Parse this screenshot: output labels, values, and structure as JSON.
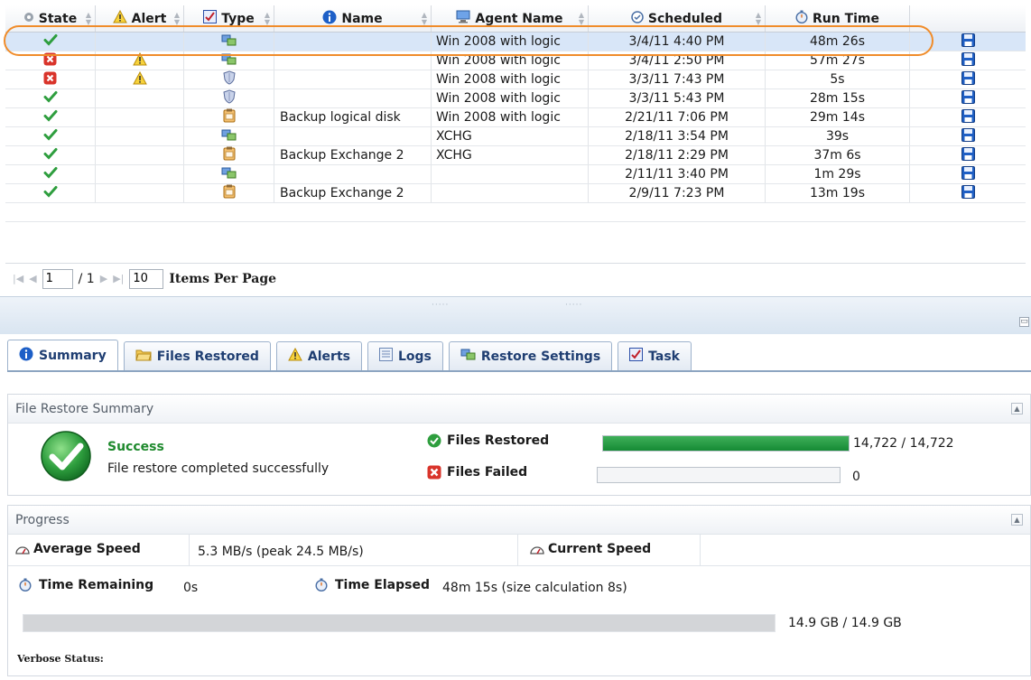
{
  "columns": {
    "state": "State",
    "alert": "Alert",
    "type": "Type",
    "name": "Name",
    "agent": "Agent Name",
    "scheduled": "Scheduled",
    "run_time": "Run Time"
  },
  "rows": [
    {
      "state": "ok",
      "alert": false,
      "type": "restore",
      "name": "",
      "agent": "Win 2008 with logic",
      "scheduled": "3/4/11 4:40 PM",
      "run_time": "48m 26s",
      "selected": true
    },
    {
      "state": "error",
      "alert": true,
      "type": "restore",
      "name": "",
      "agent": "Win 2008 with logic",
      "scheduled": "3/4/11 2:50 PM",
      "run_time": "57m 27s",
      "selected": false
    },
    {
      "state": "error",
      "alert": true,
      "type": "shield",
      "name": "",
      "agent": "Win 2008 with logic",
      "scheduled": "3/3/11 7:43 PM",
      "run_time": "5s",
      "selected": false
    },
    {
      "state": "ok",
      "alert": false,
      "type": "shield",
      "name": "",
      "agent": "Win 2008 with logic",
      "scheduled": "3/3/11 5:43 PM",
      "run_time": "28m 15s",
      "selected": false
    },
    {
      "state": "ok",
      "alert": false,
      "type": "backup",
      "name": "Backup logical disk",
      "agent": "Win 2008 with logic",
      "scheduled": "2/21/11 7:06 PM",
      "run_time": "29m 14s",
      "selected": false
    },
    {
      "state": "ok",
      "alert": false,
      "type": "restore",
      "name": "",
      "agent": "XCHG",
      "scheduled": "2/18/11 3:54 PM",
      "run_time": "39s",
      "selected": false
    },
    {
      "state": "ok",
      "alert": false,
      "type": "backup",
      "name": "Backup Exchange 2",
      "agent": "XCHG",
      "scheduled": "2/18/11 2:29 PM",
      "run_time": "37m 6s",
      "selected": false
    },
    {
      "state": "ok",
      "alert": false,
      "type": "restore",
      "name": "",
      "agent": "",
      "scheduled": "2/11/11 3:40 PM",
      "run_time": "1m 29s",
      "selected": false
    },
    {
      "state": "ok",
      "alert": false,
      "type": "backup",
      "name": "Backup Exchange 2",
      "agent": "",
      "scheduled": "2/9/11 7:23 PM",
      "run_time": "13m 19s",
      "selected": false
    }
  ],
  "pager": {
    "page": "1",
    "total": "/ 1",
    "per_page": "10",
    "per_page_label": "Items Per Page"
  },
  "tabs": [
    {
      "label": "Summary",
      "icon": "info-icon",
      "active": true
    },
    {
      "label": "Files Restored",
      "icon": "folder-icon",
      "active": false
    },
    {
      "label": "Alerts",
      "icon": "warning-icon",
      "active": false
    },
    {
      "label": "Logs",
      "icon": "log-icon",
      "active": false
    },
    {
      "label": "Restore Settings",
      "icon": "restore-icon",
      "active": false
    },
    {
      "label": "Task",
      "icon": "task-icon",
      "active": false
    }
  ],
  "summary": {
    "title": "File Restore Summary",
    "status": "Success",
    "message": "File restore completed successfully",
    "files_restored_label": "Files Restored",
    "files_restored_value": "14,722 / 14,722",
    "files_restored_fraction": 1.0,
    "files_failed_label": "Files Failed",
    "files_failed_value": "0",
    "files_failed_fraction": 0.0
  },
  "progress": {
    "title": "Progress",
    "avg_speed_label": "Average Speed",
    "avg_speed_value": "5.3 MB/s (peak 24.5 MB/s)",
    "current_speed_label": "Current Speed",
    "current_speed_value": "",
    "time_remaining_label": "Time Remaining",
    "time_remaining_value": "0s",
    "time_elapsed_label": "Time Elapsed",
    "time_elapsed_value": "48m 15s (size calculation 8s)",
    "size_value": "14.9 GB / 14.9 GB",
    "size_fraction": 1.0,
    "verbose_label": "Verbose Status:"
  },
  "colors": {
    "accent_orange": "#f08c2a",
    "success_green": "#2e9e3e",
    "error_red": "#d9342b",
    "tab_blue": "#1f3e72"
  }
}
